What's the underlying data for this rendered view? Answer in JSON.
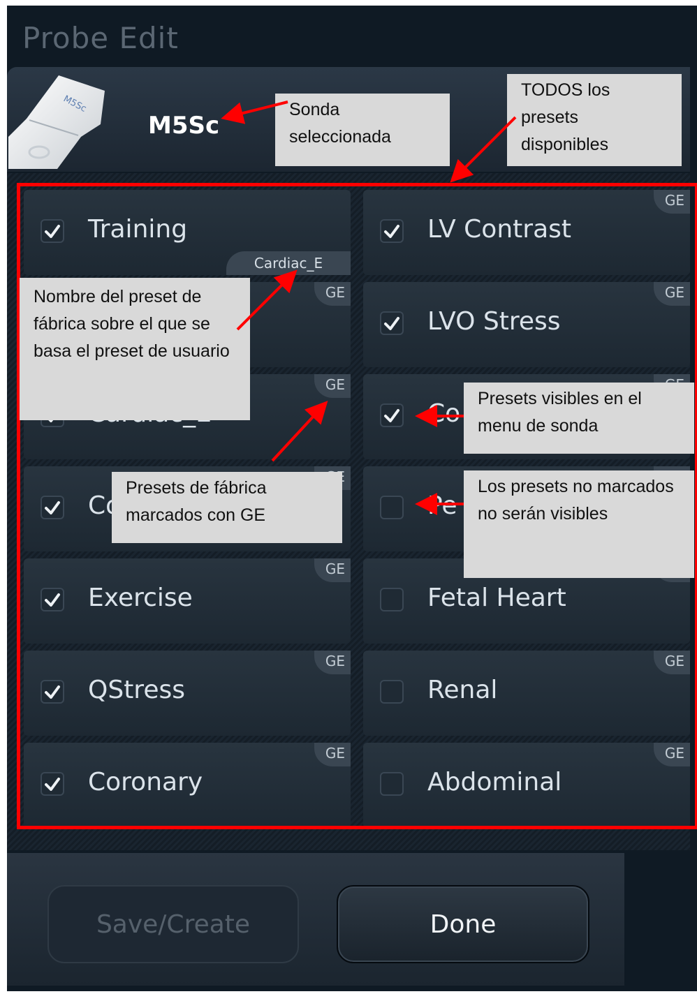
{
  "window": {
    "title": "Probe Edit"
  },
  "probe": {
    "name": "M5Sc",
    "image_label": "M5Sc"
  },
  "badges": {
    "factory": "GE"
  },
  "presets": [
    {
      "label": "Training",
      "checked": true,
      "factory_badge": false,
      "based_on": "Cardiac_E"
    },
    {
      "label": "LV Contrast",
      "checked": true,
      "factory_badge": true
    },
    {
      "label": "",
      "checked": true,
      "factory_badge": true
    },
    {
      "label": "LVO Stress",
      "checked": true,
      "factory_badge": true
    },
    {
      "label": "Cardiac_E",
      "checked": true,
      "factory_badge": true
    },
    {
      "label": "Co",
      "checked": true,
      "factory_badge": true
    },
    {
      "label": "Co",
      "checked": true,
      "factory_badge": true
    },
    {
      "label": "Pe",
      "checked": false,
      "factory_badge": true
    },
    {
      "label": "Exercise",
      "checked": true,
      "factory_badge": true
    },
    {
      "label": "Fetal Heart",
      "checked": false,
      "factory_badge": true
    },
    {
      "label": "QStress",
      "checked": true,
      "factory_badge": true
    },
    {
      "label": "Renal",
      "checked": false,
      "factory_badge": true
    },
    {
      "label": "Coronary",
      "checked": true,
      "factory_badge": true
    },
    {
      "label": "Abdominal",
      "checked": false,
      "factory_badge": true
    }
  ],
  "buttons": {
    "save": "Save/Create",
    "done": "Done"
  },
  "annotations": {
    "selected_probe": "Sonda seleccionada",
    "all_presets": "TODOS los presets disponibles",
    "base_preset": "Nombre del preset de fábrica sobre el que se basa el preset de usuario",
    "visible_presets": "Presets visibles en el menu de sonda",
    "factory_presets": "Presets de fábrica marcados con GE",
    "unchecked_presets": "Los presets no marcados no serán visibles"
  },
  "colors": {
    "annotation_arrow": "#ff0000",
    "checkmark": "#eef2f5"
  }
}
